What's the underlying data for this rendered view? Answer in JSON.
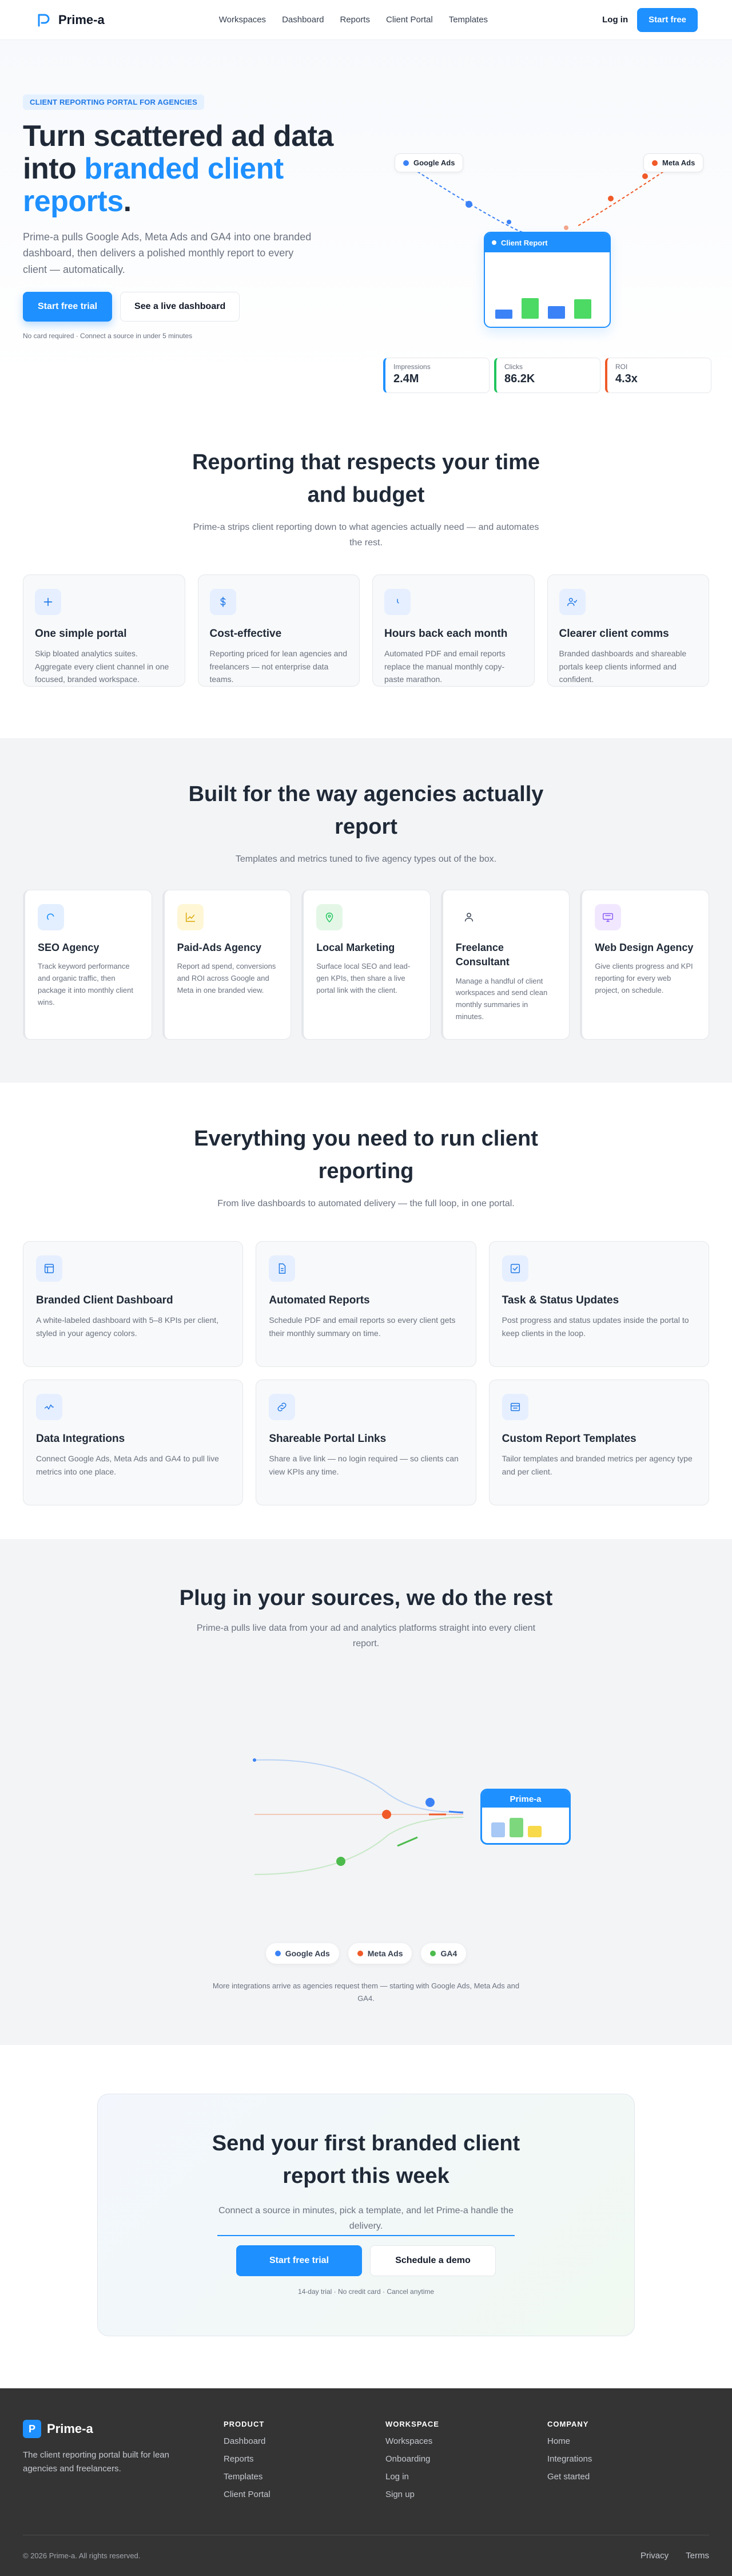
{
  "brand": {
    "name": "Prime-a",
    "accent": "#1e90ff"
  },
  "nav": {
    "links": [
      "Workspaces",
      "Dashboard",
      "Reports",
      "Client Portal",
      "Templates"
    ],
    "login": "Log in",
    "cta": "Start free"
  },
  "hero": {
    "badge": "CLIENT REPORTING PORTAL FOR AGENCIES",
    "title_part1": "Turn scattered ad data into ",
    "title_highlight": "branded client reports",
    "title_end": ".",
    "subtitle": "Prime-a pulls Google Ads, Meta Ads and GA4 into one branded dashboard, then delivers a polished monthly report to every client — automatically.",
    "cta_primary": "Start free trial",
    "cta_secondary": "See a live dashboard",
    "note": "No card required · Connect a source in under 5 minutes",
    "visual": {
      "sources": [
        "Google Ads",
        "Meta Ads"
      ],
      "report_title": "Client Report",
      "report_bars": [
        0.4,
        0.9,
        0.55,
        0.85
      ],
      "metrics": [
        {
          "label": "Impressions",
          "value": "2.4M",
          "color": "#1e90ff"
        },
        {
          "label": "Clicks",
          "value": "86.2K",
          "color": "#22c55e"
        },
        {
          "label": "ROI",
          "value": "4.3x",
          "color": "#f05a28"
        }
      ]
    }
  },
  "why": {
    "title": "Reporting that respects your time and budget",
    "subtitle": "Prime-a strips client reporting down to what agencies actually need — and automates the rest.",
    "cards": [
      {
        "icon": "plus-icon",
        "title": "One simple portal",
        "text": "Skip bloated analytics suites. Aggregate every client channel in one focused, branded workspace."
      },
      {
        "icon": "dollar-icon",
        "title": "Cost-effective",
        "text": "Reporting priced for lean agencies and freelancers — not enterprise data teams."
      },
      {
        "icon": "clock-icon",
        "title": "Hours back each month",
        "text": "Automated PDF and email reports replace the manual monthly copy-paste marathon."
      },
      {
        "icon": "users-icon",
        "title": "Clearer client comms",
        "text": "Branded dashboards and shareable portals keep clients informed and confident."
      }
    ]
  },
  "agencies": {
    "title": "Built for the way agencies actually report",
    "subtitle": "Templates and metrics tuned to five agency types out of the box.",
    "cards": [
      {
        "icon": "search-icon",
        "color": "#e3efff",
        "stroke": "#1e90ff",
        "title": "SEO Agency",
        "text": "Track keyword performance and organic traffic, then package it into monthly client wins."
      },
      {
        "icon": "chart-icon",
        "color": "#fff6d6",
        "stroke": "#d9a600",
        "title": "Paid-Ads Agency",
        "text": "Report ad spend, conversions and ROI across Google and Meta in one branded view."
      },
      {
        "icon": "map-pin-icon",
        "color": "#e4f7e7",
        "stroke": "#22c55e",
        "title": "Local Marketing",
        "text": "Surface local SEO and lead-gen KPIs, then share a live portal link with the client."
      },
      {
        "icon": "person-icon",
        "color": "#ffffff",
        "stroke": "#374151",
        "title": "Freelance Consultant",
        "text": "Manage a handful of client workspaces and send clean monthly summaries in minutes."
      },
      {
        "icon": "monitor-icon",
        "color": "#f1e8ff",
        "stroke": "#8b5cf6",
        "title": "Web Design Agency",
        "text": "Give clients progress and KPI reporting for every web project, on schedule."
      }
    ]
  },
  "features": {
    "title": "Everything you need to run client reporting",
    "subtitle": "From live dashboards to automated delivery — the full loop, in one portal.",
    "cards": [
      {
        "icon": "dashboard-icon",
        "title": "Branded Client Dashboard",
        "text": "A white-labeled dashboard with 5–8 KPIs per client, styled in your agency colors."
      },
      {
        "icon": "document-icon",
        "title": "Automated Reports",
        "text": "Schedule PDF and email reports so every client gets their monthly summary on time."
      },
      {
        "icon": "checkbox-icon",
        "title": "Task & Status Updates",
        "text": "Post progress and status updates inside the portal to keep clients in the loop."
      },
      {
        "icon": "plug-icon",
        "title": "Data Integrations",
        "text": "Connect Google Ads, Meta Ads and GA4 to pull live metrics into one place."
      },
      {
        "icon": "link-icon",
        "title": "Shareable Portal Links",
        "text": "Share a live link — no login required — so clients can view KPIs any time."
      },
      {
        "icon": "template-icon",
        "title": "Custom Report Templates",
        "text": "Tailor templates and branded metrics per agency type and per client."
      }
    ]
  },
  "integrations": {
    "title": "Plug in your sources, we do the rest",
    "subtitle": "Prime-a pulls live data from your ad and analytics platforms straight into every client report.",
    "hub_label": "Prime-a",
    "sources": [
      {
        "name": "Google Ads",
        "color": "#3b82f6"
      },
      {
        "name": "Meta Ads",
        "color": "#f05a28"
      },
      {
        "name": "GA4",
        "color": "#4cbb4c"
      }
    ],
    "note": "More integrations arrive as agencies request them — starting with Google Ads, Meta Ads and GA4."
  },
  "cta": {
    "title": "Send your first branded client report this week",
    "subtitle": "Connect a source in minutes, pick a template, and let Prime-a handle the delivery.",
    "primary": "Start free trial",
    "secondary": "Schedule a demo",
    "note": "14-day trial · No credit card · Cancel anytime"
  },
  "footer": {
    "tagline": "The client reporting portal built for lean agencies and freelancers.",
    "columns": [
      {
        "heading": "PRODUCT",
        "links": [
          "Dashboard",
          "Reports",
          "Templates",
          "Client Portal"
        ]
      },
      {
        "heading": "WORKSPACE",
        "links": [
          "Workspaces",
          "Onboarding",
          "Log in",
          "Sign up"
        ]
      },
      {
        "heading": "COMPANY",
        "links": [
          "Home",
          "Integrations",
          "Get started"
        ]
      }
    ],
    "copyright": "© 2026 Prime-a. All rights reserved.",
    "legal": [
      "Privacy",
      "Terms"
    ]
  }
}
